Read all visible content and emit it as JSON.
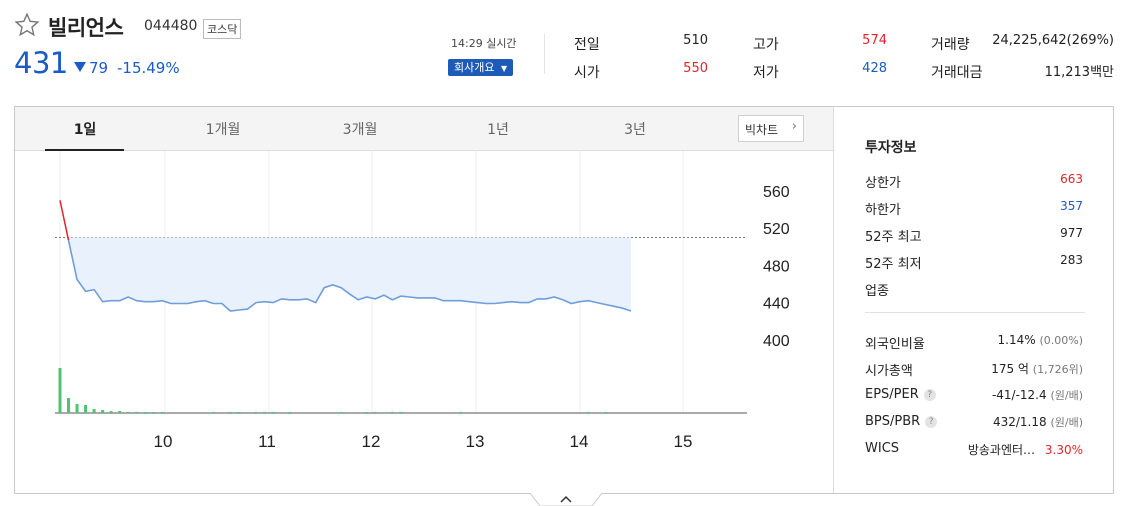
{
  "header": {
    "name": "빌리언스",
    "code": "044480",
    "market": "코스닥",
    "price": "431",
    "change_amount": "79",
    "change_percent": "-15.49%",
    "realtime": "14:29 실시간",
    "company_button": "회사개요"
  },
  "quote": {
    "prev_close_label": "전일",
    "prev_close": "510",
    "open_label": "시가",
    "open": "550",
    "high_label": "고가",
    "high": "574",
    "low_label": "저가",
    "low": "428",
    "volume_label": "거래량",
    "volume": "24,225,642(269%)",
    "value_label": "거래대금",
    "value": "11,213백만"
  },
  "tabs": [
    "1일",
    "1개월",
    "3개월",
    "1년",
    "3년"
  ],
  "big_chart_label": "빅차트",
  "side": {
    "title": "투자정보",
    "upper_limit_label": "상한가",
    "upper_limit": "663",
    "lower_limit_label": "하한가",
    "lower_limit": "357",
    "high52_label": "52주 최고",
    "high52": "977",
    "low52_label": "52주 최저",
    "low52": "283",
    "sector_label": "업종",
    "foreign_label": "외국인비율",
    "foreign": "1.14%",
    "foreign_sub": "(0.00%)",
    "mcap_label": "시가총액",
    "mcap": "175 억",
    "mcap_sub": "(1,726위)",
    "eps_label": "EPS/PER",
    "eps": "-41/-12.4",
    "eps_sub": "(원/배)",
    "bps_label": "BPS/PBR",
    "bps": "432/1.18",
    "bps_sub": "(원/배)",
    "wics_label": "WICS",
    "wics_sector": "방송과엔터…",
    "wics_pct": "3.30%"
  },
  "colors": {
    "up": "#e0262b",
    "down": "#1a5ac9",
    "line": "#6f9ed8",
    "fill": "#e8f1fc",
    "volume": "#4fc46f"
  },
  "chart_data": {
    "type": "line",
    "title": "",
    "y_ticks": [
      "560",
      "520",
      "480",
      "440",
      "400"
    ],
    "x_ticks": [
      "10",
      "11",
      "12",
      "13",
      "14",
      "15"
    ],
    "ylim": [
      400,
      575
    ],
    "reference_price": 510,
    "price": [
      550,
      507,
      465,
      452,
      454,
      441,
      442,
      442,
      446,
      442,
      441,
      441,
      442,
      439,
      439,
      439,
      441,
      442,
      439,
      439,
      431,
      432,
      433,
      440,
      441,
      440,
      444,
      443,
      443,
      444,
      440,
      456,
      459,
      456,
      449,
      443,
      446,
      444,
      448,
      443,
      447,
      446,
      445,
      445,
      445,
      442,
      442,
      442,
      441,
      440,
      439,
      439,
      440,
      441,
      440,
      440,
      444,
      444,
      446,
      443,
      439,
      441,
      442,
      440,
      438,
      436,
      434,
      431
    ],
    "volume": [
      45,
      15,
      9,
      8,
      4,
      3,
      2,
      2,
      1,
      1,
      1,
      1,
      1,
      0,
      0,
      0,
      0,
      0,
      1,
      0,
      1,
      1,
      0,
      1,
      1,
      1,
      0,
      1,
      0,
      0,
      0,
      0,
      0,
      1,
      0,
      0,
      1,
      1,
      0,
      1,
      1,
      0,
      0,
      0,
      0,
      0,
      0,
      1,
      0,
      0,
      0,
      0,
      0,
      0,
      0,
      0,
      0,
      0,
      0,
      0,
      0,
      0,
      1,
      0,
      1,
      0,
      0,
      0
    ]
  }
}
